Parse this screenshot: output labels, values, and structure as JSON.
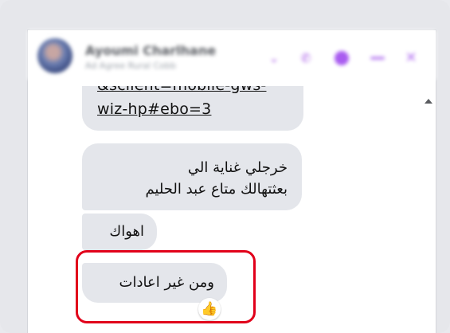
{
  "header": {
    "contact_name": "Ayoumi Charlhane",
    "status": "Ad Agree Rural Cobb",
    "icons": [
      "phone-icon",
      "video-call-icon",
      "minimize-icon",
      "close-icon"
    ]
  },
  "messages": [
    {
      "id": "m1",
      "lines": [
        "&sclient=mobile-gws-",
        "wiz-hp#ebo=3"
      ],
      "is_link": true
    },
    {
      "id": "m2",
      "lines": [
        "خرجلي غناية الي",
        "بعثتهالك متاع عبد الحليم"
      ]
    },
    {
      "id": "m3",
      "lines": [
        "اهواك"
      ]
    },
    {
      "id": "m4",
      "lines": [
        "ومن غير اعادات"
      ],
      "reaction": "👍",
      "highlighted": true
    }
  ],
  "colors": {
    "bubble": "#e4e6eb",
    "highlight_border": "#e1001a",
    "accent": "#a454e6"
  }
}
